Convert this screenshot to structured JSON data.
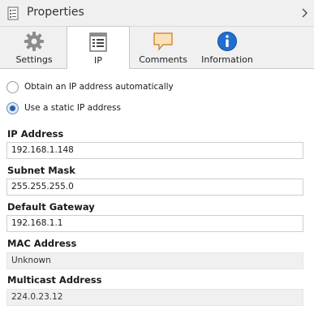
{
  "window": {
    "title": "Properties"
  },
  "tabs": [
    {
      "label": "Settings",
      "icon": "gear-icon"
    },
    {
      "label": "IP",
      "icon": "ip-config-icon",
      "active": true
    },
    {
      "label": "Comments",
      "icon": "comment-icon"
    },
    {
      "label": "Information",
      "icon": "info-icon"
    }
  ],
  "ip_mode": {
    "auto_label": "Obtain an IP address automatically",
    "static_label": "Use a static IP address",
    "selected": "static"
  },
  "fields": {
    "ip_address": {
      "label": "IP Address",
      "value": "192.168.1.148"
    },
    "subnet_mask": {
      "label": "Subnet Mask",
      "value": "255.255.255.0"
    },
    "default_gateway": {
      "label": "Default Gateway",
      "value": "192.168.1.1"
    },
    "mac_address": {
      "label": "MAC Address",
      "value": "Unknown"
    },
    "multicast_address": {
      "label": "Multicast Address",
      "value": "224.0.23.12"
    }
  },
  "colors": {
    "accent": "#2c5fa8",
    "info_blue": "#1e6fd0",
    "comment_orange": "#f0a040"
  }
}
